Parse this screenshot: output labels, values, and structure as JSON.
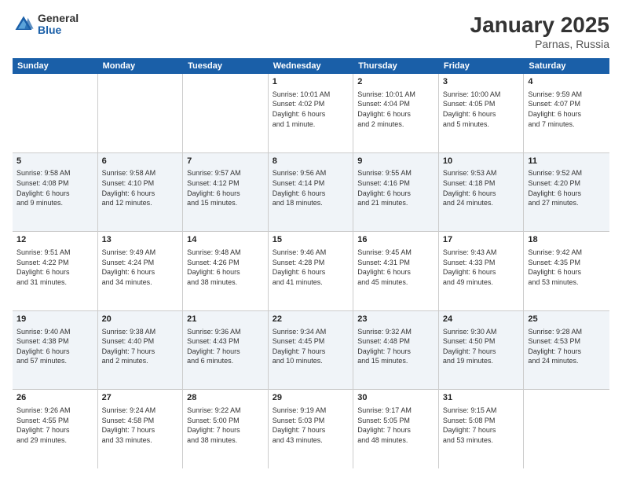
{
  "header": {
    "logo_general": "General",
    "logo_blue": "Blue",
    "month": "January 2025",
    "location": "Parnas, Russia"
  },
  "weekdays": [
    "Sunday",
    "Monday",
    "Tuesday",
    "Wednesday",
    "Thursday",
    "Friday",
    "Saturday"
  ],
  "weeks": [
    [
      {
        "day": "",
        "info": ""
      },
      {
        "day": "",
        "info": ""
      },
      {
        "day": "",
        "info": ""
      },
      {
        "day": "1",
        "info": "Sunrise: 10:01 AM\nSunset: 4:02 PM\nDaylight: 6 hours\nand 1 minute."
      },
      {
        "day": "2",
        "info": "Sunrise: 10:01 AM\nSunset: 4:04 PM\nDaylight: 6 hours\nand 2 minutes."
      },
      {
        "day": "3",
        "info": "Sunrise: 10:00 AM\nSunset: 4:05 PM\nDaylight: 6 hours\nand 5 minutes."
      },
      {
        "day": "4",
        "info": "Sunrise: 9:59 AM\nSunset: 4:07 PM\nDaylight: 6 hours\nand 7 minutes."
      }
    ],
    [
      {
        "day": "5",
        "info": "Sunrise: 9:58 AM\nSunset: 4:08 PM\nDaylight: 6 hours\nand 9 minutes."
      },
      {
        "day": "6",
        "info": "Sunrise: 9:58 AM\nSunset: 4:10 PM\nDaylight: 6 hours\nand 12 minutes."
      },
      {
        "day": "7",
        "info": "Sunrise: 9:57 AM\nSunset: 4:12 PM\nDaylight: 6 hours\nand 15 minutes."
      },
      {
        "day": "8",
        "info": "Sunrise: 9:56 AM\nSunset: 4:14 PM\nDaylight: 6 hours\nand 18 minutes."
      },
      {
        "day": "9",
        "info": "Sunrise: 9:55 AM\nSunset: 4:16 PM\nDaylight: 6 hours\nand 21 minutes."
      },
      {
        "day": "10",
        "info": "Sunrise: 9:53 AM\nSunset: 4:18 PM\nDaylight: 6 hours\nand 24 minutes."
      },
      {
        "day": "11",
        "info": "Sunrise: 9:52 AM\nSunset: 4:20 PM\nDaylight: 6 hours\nand 27 minutes."
      }
    ],
    [
      {
        "day": "12",
        "info": "Sunrise: 9:51 AM\nSunset: 4:22 PM\nDaylight: 6 hours\nand 31 minutes."
      },
      {
        "day": "13",
        "info": "Sunrise: 9:49 AM\nSunset: 4:24 PM\nDaylight: 6 hours\nand 34 minutes."
      },
      {
        "day": "14",
        "info": "Sunrise: 9:48 AM\nSunset: 4:26 PM\nDaylight: 6 hours\nand 38 minutes."
      },
      {
        "day": "15",
        "info": "Sunrise: 9:46 AM\nSunset: 4:28 PM\nDaylight: 6 hours\nand 41 minutes."
      },
      {
        "day": "16",
        "info": "Sunrise: 9:45 AM\nSunset: 4:31 PM\nDaylight: 6 hours\nand 45 minutes."
      },
      {
        "day": "17",
        "info": "Sunrise: 9:43 AM\nSunset: 4:33 PM\nDaylight: 6 hours\nand 49 minutes."
      },
      {
        "day": "18",
        "info": "Sunrise: 9:42 AM\nSunset: 4:35 PM\nDaylight: 6 hours\nand 53 minutes."
      }
    ],
    [
      {
        "day": "19",
        "info": "Sunrise: 9:40 AM\nSunset: 4:38 PM\nDaylight: 6 hours\nand 57 minutes."
      },
      {
        "day": "20",
        "info": "Sunrise: 9:38 AM\nSunset: 4:40 PM\nDaylight: 7 hours\nand 2 minutes."
      },
      {
        "day": "21",
        "info": "Sunrise: 9:36 AM\nSunset: 4:43 PM\nDaylight: 7 hours\nand 6 minutes."
      },
      {
        "day": "22",
        "info": "Sunrise: 9:34 AM\nSunset: 4:45 PM\nDaylight: 7 hours\nand 10 minutes."
      },
      {
        "day": "23",
        "info": "Sunrise: 9:32 AM\nSunset: 4:48 PM\nDaylight: 7 hours\nand 15 minutes."
      },
      {
        "day": "24",
        "info": "Sunrise: 9:30 AM\nSunset: 4:50 PM\nDaylight: 7 hours\nand 19 minutes."
      },
      {
        "day": "25",
        "info": "Sunrise: 9:28 AM\nSunset: 4:53 PM\nDaylight: 7 hours\nand 24 minutes."
      }
    ],
    [
      {
        "day": "26",
        "info": "Sunrise: 9:26 AM\nSunset: 4:55 PM\nDaylight: 7 hours\nand 29 minutes."
      },
      {
        "day": "27",
        "info": "Sunrise: 9:24 AM\nSunset: 4:58 PM\nDaylight: 7 hours\nand 33 minutes."
      },
      {
        "day": "28",
        "info": "Sunrise: 9:22 AM\nSunset: 5:00 PM\nDaylight: 7 hours\nand 38 minutes."
      },
      {
        "day": "29",
        "info": "Sunrise: 9:19 AM\nSunset: 5:03 PM\nDaylight: 7 hours\nand 43 minutes."
      },
      {
        "day": "30",
        "info": "Sunrise: 9:17 AM\nSunset: 5:05 PM\nDaylight: 7 hours\nand 48 minutes."
      },
      {
        "day": "31",
        "info": "Sunrise: 9:15 AM\nSunset: 5:08 PM\nDaylight: 7 hours\nand 53 minutes."
      },
      {
        "day": "",
        "info": ""
      }
    ]
  ]
}
